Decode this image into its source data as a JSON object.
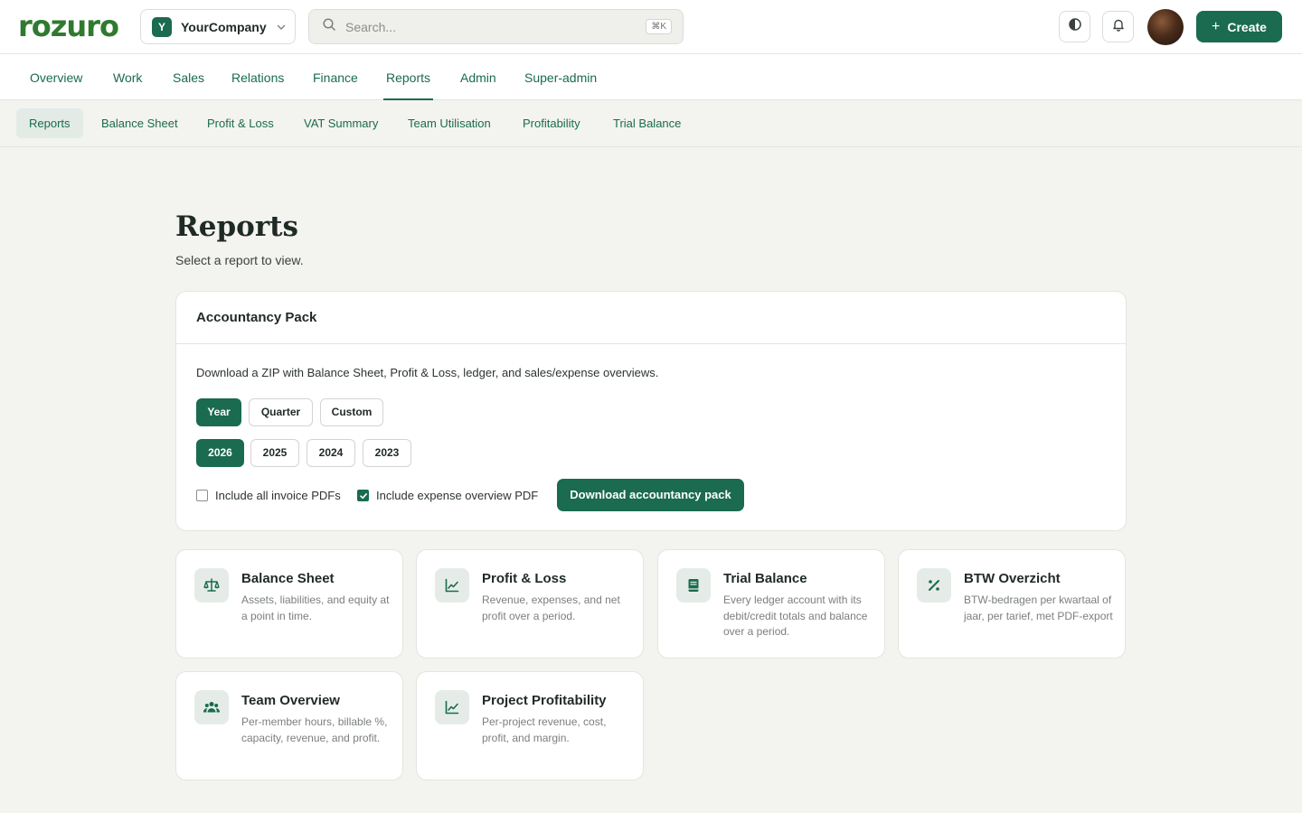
{
  "topbar": {
    "logo": "rozuro",
    "company": {
      "initial": "Y",
      "name": "YourCompany"
    },
    "search": {
      "placeholder": "Search...",
      "shortcut": "⌘K"
    },
    "create_label": "Create"
  },
  "main_nav": {
    "items": [
      "Overview",
      "Work",
      "Sales",
      "Relations",
      "Finance",
      "Reports",
      "Admin",
      "Super-admin"
    ],
    "active": "Reports"
  },
  "sub_nav": {
    "items": [
      "Reports",
      "Balance Sheet",
      "Profit & Loss",
      "VAT Summary",
      "Team Utilisation",
      "Profitability",
      "Trial Balance"
    ],
    "active": "Reports"
  },
  "page": {
    "title": "Reports",
    "subtitle": "Select a report to view."
  },
  "pack": {
    "title": "Accountancy Pack",
    "description": "Download a ZIP with Balance Sheet, Profit & Loss, ledger, and sales/expense overviews.",
    "periods": [
      "Year",
      "Quarter",
      "Custom"
    ],
    "selected_period": "Year",
    "years": [
      "2026",
      "2025",
      "2024",
      "2023"
    ],
    "selected_year": "2026",
    "include_invoices": {
      "label": "Include all invoice PDFs",
      "checked": false
    },
    "include_expense": {
      "label": "Include expense overview PDF",
      "checked": true
    },
    "download_label": "Download accountancy pack"
  },
  "reports": [
    {
      "icon": "scale-icon",
      "title": "Balance Sheet",
      "description": "Assets, liabilities, and equity at a point in time."
    },
    {
      "icon": "line-chart-icon",
      "title": "Profit & Loss",
      "description": "Revenue, expenses, and net profit over a period."
    },
    {
      "icon": "book-icon",
      "title": "Trial Balance",
      "description": "Every ledger account with its debit/credit totals and balance over a period."
    },
    {
      "icon": "percent-icon",
      "title": "BTW Overzicht",
      "description": "BTW-bedragen per kwartaal of jaar, per tarief, met PDF-export"
    },
    {
      "icon": "users-icon",
      "title": "Team Overview",
      "description": "Per-member hours, billable %, capacity, revenue, and profit."
    },
    {
      "icon": "line-chart-icon",
      "title": "Project Profitability",
      "description": "Per-project revenue, cost, profit, and margin."
    }
  ],
  "colors": {
    "brand": "#1a6b4f",
    "logo": "#2f7a2f"
  }
}
